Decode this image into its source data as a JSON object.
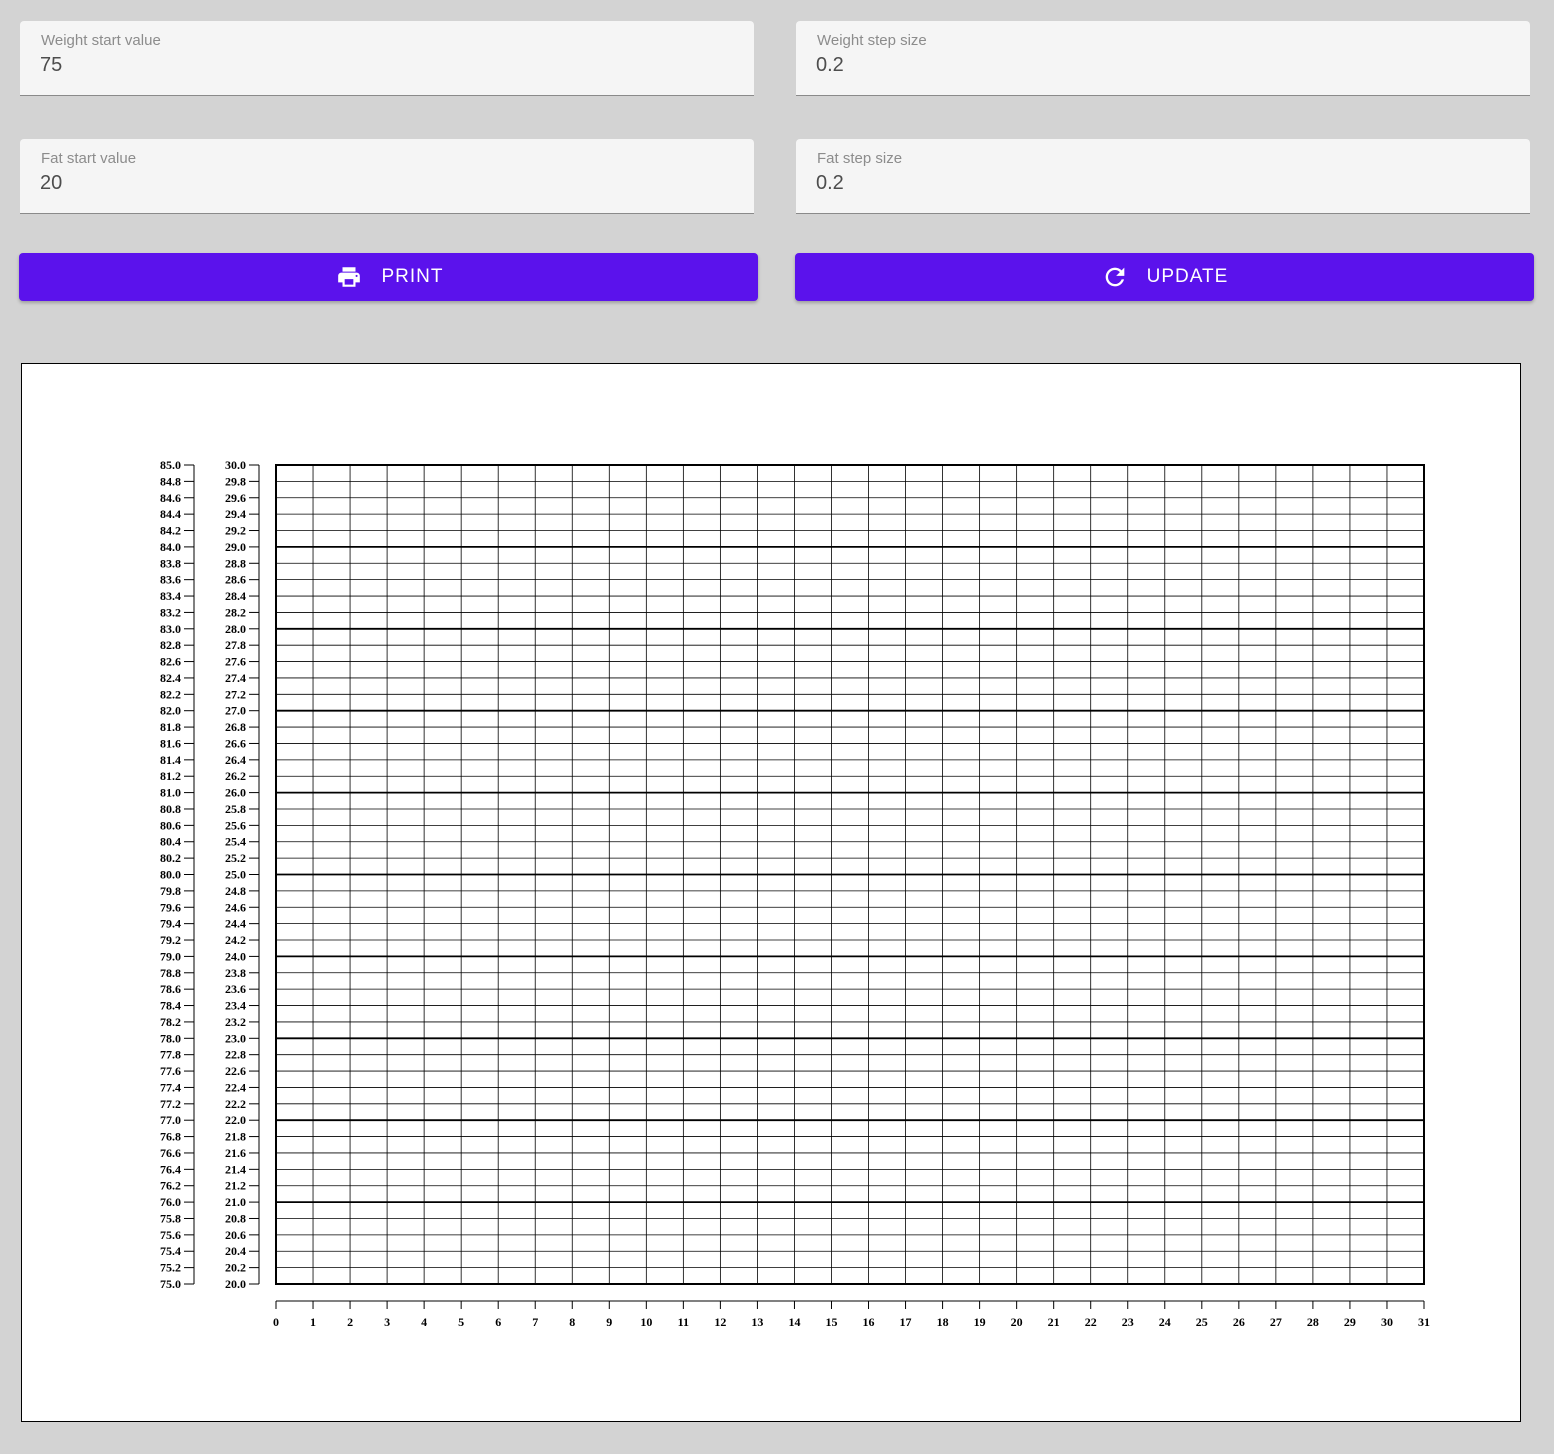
{
  "form": {
    "weight_start": {
      "label": "Weight start value",
      "value": "75"
    },
    "weight_step": {
      "label": "Weight step size",
      "value": "0.2"
    },
    "fat_start": {
      "label": "Fat start value",
      "value": "20"
    },
    "fat_step": {
      "label": "Fat step size",
      "value": "0.2"
    }
  },
  "buttons": {
    "print": {
      "label": "PRINT",
      "icon": "printer-icon"
    },
    "update": {
      "label": "UPDATE",
      "icon": "refresh-icon"
    }
  },
  "colors": {
    "accent": "#5b12ec",
    "background": "#d3d3d3"
  },
  "chart_data": {
    "type": "line",
    "title": "",
    "x": {
      "min": 0,
      "max": 31,
      "step": 1
    },
    "y_axes": [
      {
        "name": "weight",
        "min": 75.0,
        "max": 85.0,
        "step": 0.2
      },
      {
        "name": "fat",
        "min": 20.0,
        "max": 30.0,
        "step": 0.2
      }
    ],
    "grid": true,
    "major_grid_every": 1.0,
    "series": []
  }
}
